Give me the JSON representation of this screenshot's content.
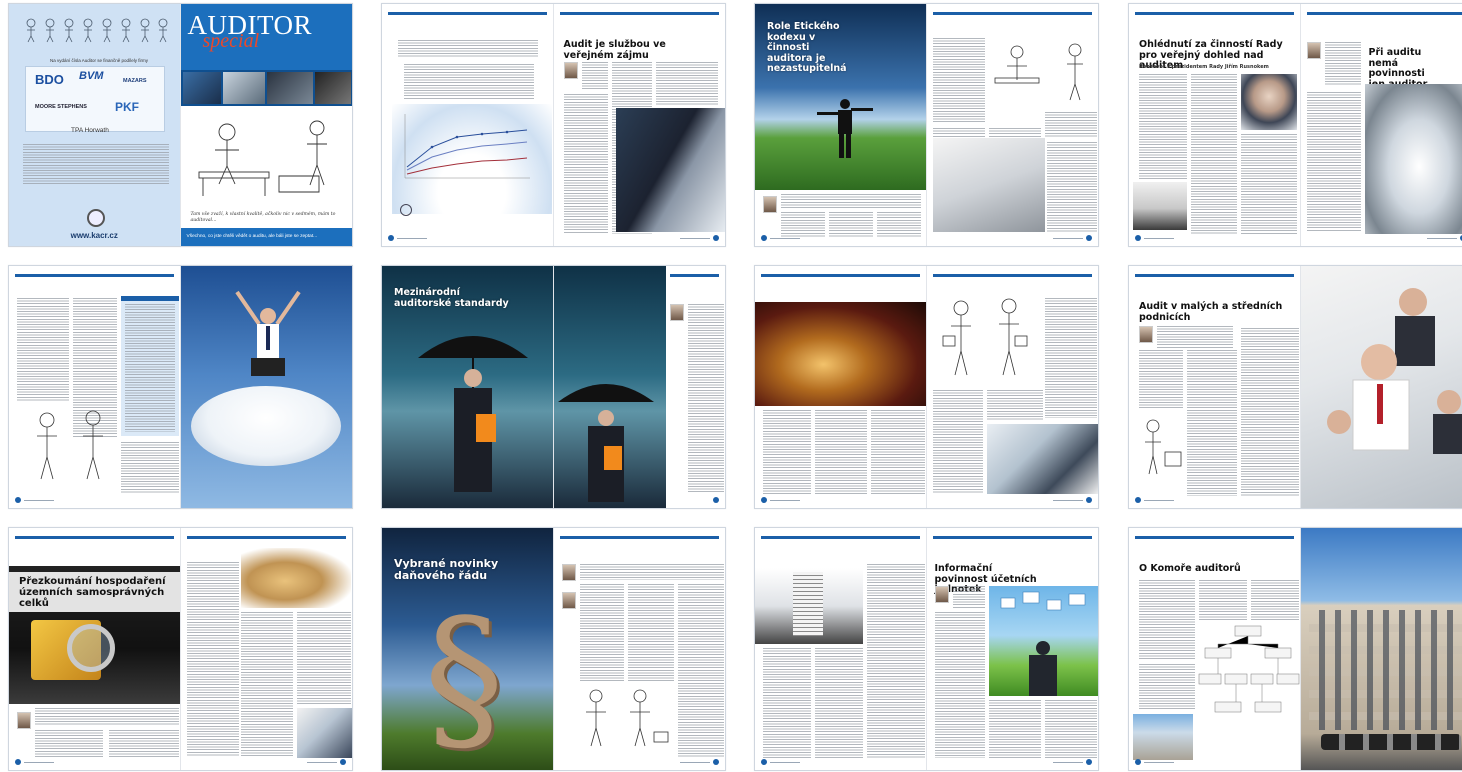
{
  "cover": {
    "left_intro": "Na vydání čísla Auditor se finančně podílely firmy",
    "sponsors": [
      "BDO",
      "BVM",
      "MAZARS",
      "MOORE STEPHENS",
      "PKF",
      "TPA Horwath"
    ],
    "website": "www.kacr.cz",
    "masthead": "AUDITOR",
    "masthead_special": "special",
    "headline": "Všechno, co jste chtěli vědět o auditu, ale báli jste se zeptat...",
    "cartoon_caption": "Tam vše zvaží, k vlastní kvalitě, ačkoliv nic v sedmém, mám to auditoval..."
  },
  "articles": {
    "audit_public_interest": "Audit je službou ve veřejném zájmu",
    "ethics_role": "Role Etického kodexu v činnosti auditora je nezastupitelná",
    "oversight_title": "Ohlédnutí za činností Rady pro veřejný dohled nad auditem",
    "oversight_subtitle": "Rozhovor s prezidentem Rady Jiřím Rusnokem",
    "no_obligation": "Při auditu nemá povinnosti jen auditor",
    "isa": "Mezinárodní auditorské standardy",
    "sme_audit": "Audit v malých a středních podnicích",
    "municipal_review": "Přezkoumání hospodaření územních samosprávných celků",
    "tax_news": "Vybrané novinky daňového řádu",
    "information_duty": "Informační povinnost účetních jednotek",
    "chamber": "O Komoře auditorů"
  },
  "colors": {
    "accent_blue": "#1b5fa8",
    "cover_blue": "#1c6fbd",
    "special_red": "#e8492b"
  }
}
